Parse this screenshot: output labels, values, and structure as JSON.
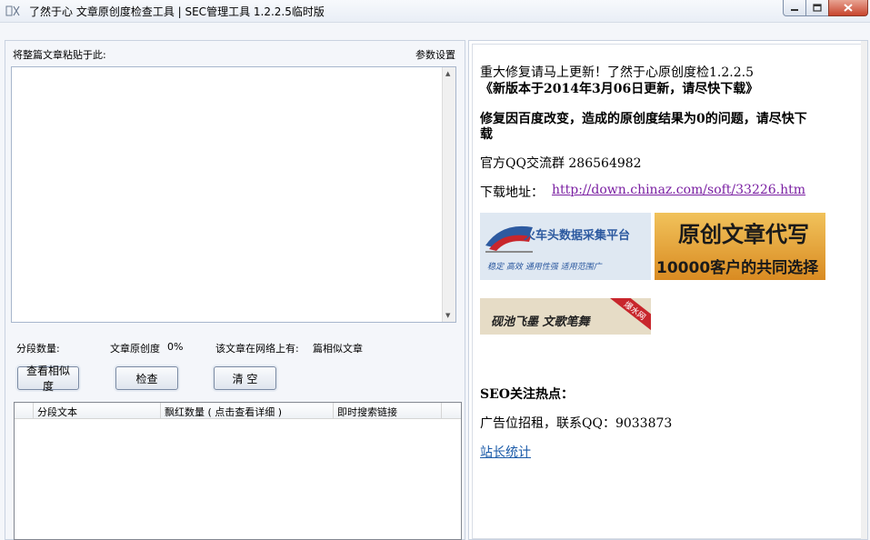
{
  "window": {
    "title": "了然于心 文章原创度检查工具 | SEC管理工具  1.2.2.5临时版"
  },
  "left": {
    "paste_label": "将整篇文章粘贴于此:",
    "settings_label": "参数设置",
    "paste_value": "",
    "stats": {
      "segments_label": "分段数量:",
      "originality_label": "文章原创度",
      "originality_value": "0%",
      "online_label": "该文章在网络上有:",
      "similar_label": "篇相似文章"
    },
    "buttons": {
      "similarity": "查看相似度",
      "check": "检查",
      "clear": "清 空"
    },
    "table": {
      "columns": [
        "分段文本",
        "飘红数量 ( 点击查看详细 )",
        "即时搜索链接"
      ]
    }
  },
  "right": {
    "headline": "重大修复请马上更新！了然于心原创度检1.2.2.5",
    "update_notice": "《新版本于2014年3月06日更新，请尽快下载》",
    "fix_line1": "修复因百度改变，造成的原创度结果为0的问题，请尽快下",
    "fix_line2": "载",
    "qq_group": "官方QQ交流群 286564982",
    "download_label": "下载地址：",
    "download_url": "http://down.chinaz.com/soft/33226.htm",
    "banner1": {
      "title": "火车头数据采集平台",
      "tagline": "稳定  高效  通用性强  适用范围广",
      "colors": {
        "bg": "#dfe8f2",
        "accent": "#c8262c",
        "blue": "#2d5aa0"
      }
    },
    "banner2": {
      "title": "原创文章代写",
      "subtitle": "10000客户的共同选择",
      "colors": {
        "bg": "#e2a03a",
        "text": "#1a1a1a"
      }
    },
    "banner3": {
      "text": "砚池飞墨  文歌笔舞",
      "ribbon": "爆水网",
      "colors": {
        "bg": "#e6dcc6",
        "ribbon": "#c8262c"
      }
    },
    "seo_heading": "SEO关注热点：",
    "ad_text": "广告位招租，联系QQ：9033873",
    "stats_link": "站长统计"
  }
}
